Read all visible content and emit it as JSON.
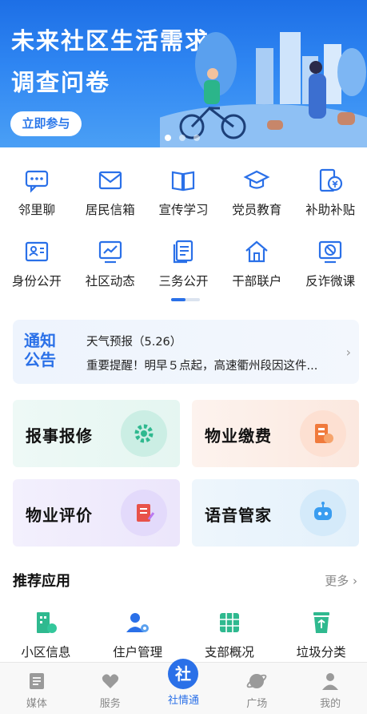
{
  "banner": {
    "title_line1": "未来社区生活需求",
    "title_line2": "调查问卷",
    "cta": "立即参与",
    "slide_count": 3,
    "active_slide": 1
  },
  "grid": {
    "row1": [
      {
        "label": "邻里聊",
        "icon": "chat-icon"
      },
      {
        "label": "居民信箱",
        "icon": "mail-icon"
      },
      {
        "label": "宣传学习",
        "icon": "book-icon"
      },
      {
        "label": "党员教育",
        "icon": "graduation-cap-icon"
      },
      {
        "label": "补助补贴",
        "icon": "subsidy-icon"
      }
    ],
    "row2": [
      {
        "label": "身份公开",
        "icon": "id-card-icon"
      },
      {
        "label": "社区动态",
        "icon": "trend-chart-icon"
      },
      {
        "label": "三务公开",
        "icon": "documents-icon"
      },
      {
        "label": "干部联户",
        "icon": "home-icon"
      },
      {
        "label": "反诈微课",
        "icon": "anti-fraud-icon"
      }
    ]
  },
  "notice": {
    "tag_line1": "通知",
    "tag_line2": "公告",
    "line1": "天气预报（5.26）",
    "line2": "重要提醒！明早５点起，高速衢州段因这件..."
  },
  "cards": [
    {
      "label": "报事报修",
      "icon": "gear-icon",
      "color": "#2fb98f"
    },
    {
      "label": "物业缴费",
      "icon": "bill-icon",
      "color": "#f07a3c"
    },
    {
      "label": "物业评价",
      "icon": "notebook-icon",
      "color": "#e8524a"
    },
    {
      "label": "语音管家",
      "icon": "robot-icon",
      "color": "#3a9df0"
    }
  ],
  "recommended": {
    "title": "推荐应用",
    "more": "更多 ›",
    "apps": [
      {
        "label": "小区信息",
        "icon": "building-icon"
      },
      {
        "label": "住户管理",
        "icon": "user-settings-icon"
      },
      {
        "label": "支部概况",
        "icon": "grid-icon"
      },
      {
        "label": "垃圾分类",
        "icon": "recycle-bin-icon"
      }
    ]
  },
  "tabbar": {
    "tabs": [
      {
        "label": "媒体",
        "icon": "news-icon"
      },
      {
        "label": "服务",
        "icon": "heart-icon"
      },
      {
        "label": "社情通",
        "icon": "community-logo-icon",
        "active": true
      },
      {
        "label": "广场",
        "icon": "planet-icon"
      },
      {
        "label": "我的",
        "icon": "person-icon"
      }
    ],
    "active_color": "#2a70e8"
  },
  "colors": {
    "accent": "#2a70e8",
    "banner": "#1d6fe6"
  }
}
